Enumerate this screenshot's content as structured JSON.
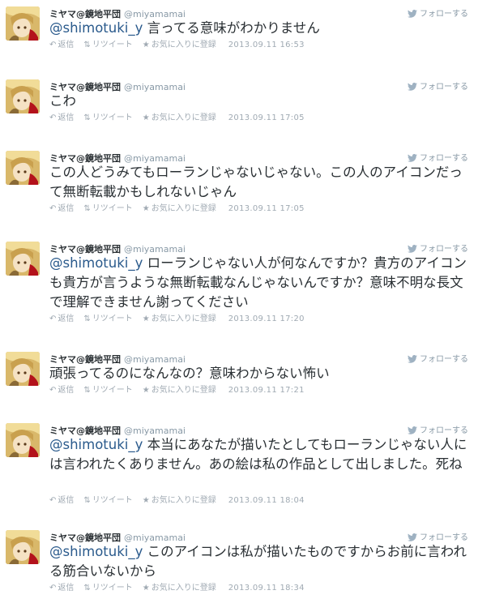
{
  "labels": {
    "follow": "フォローする",
    "reply": "返信",
    "retweet": "リツイート",
    "favorite": "お気に入りに登録"
  },
  "user": {
    "name": "ミヤマ@鏡地平団",
    "handle": "@miyamamai"
  },
  "icons": {
    "reply": "reply-arrow-icon",
    "retweet": "retweet-icon",
    "favorite": "star-icon",
    "follow": "twitter-bird-icon"
  },
  "colors": {
    "mention": "#2a5a8c",
    "meta": "#8899a6"
  },
  "tweets": [
    {
      "mention": "@shimotuki_y",
      "text": " 言ってる意味がわかりません",
      "timestamp": "2013.09.11 16:53"
    },
    {
      "mention": "",
      "text": "こわ",
      "timestamp": "2013.09.11 17:05"
    },
    {
      "mention": "",
      "text": "この人どうみてもローランじゃないじゃない。この人のアイコンだって無断転載かもしれないじゃん",
      "timestamp": "2013.09.11 17:05"
    },
    {
      "mention": "@shimotuki_y",
      "text": " ローランじゃない人が何なんですか？貴方のアイコンも貴方が言うような無断転載なんじゃないんですか？意味不明な長文で理解できません謝ってください",
      "timestamp": "2013.09.11 17:20"
    },
    {
      "mention": "",
      "text": "頑張ってるのになんなの？意味わからない怖い",
      "timestamp": "2013.09.11 17:21"
    },
    {
      "mention": "@shimotuki_y",
      "text": " 本当にあなたが描いたとしてもローランじゃない人には言われたくありません。あの絵は私の作品として出しました。死ね",
      "timestamp": "2013.09.11 18:04"
    },
    {
      "mention": "@shimotuki_y",
      "text": " このアイコンは私が描いたものですからお前に言われる筋合いないから",
      "timestamp": "2013.09.11 18:34"
    }
  ]
}
